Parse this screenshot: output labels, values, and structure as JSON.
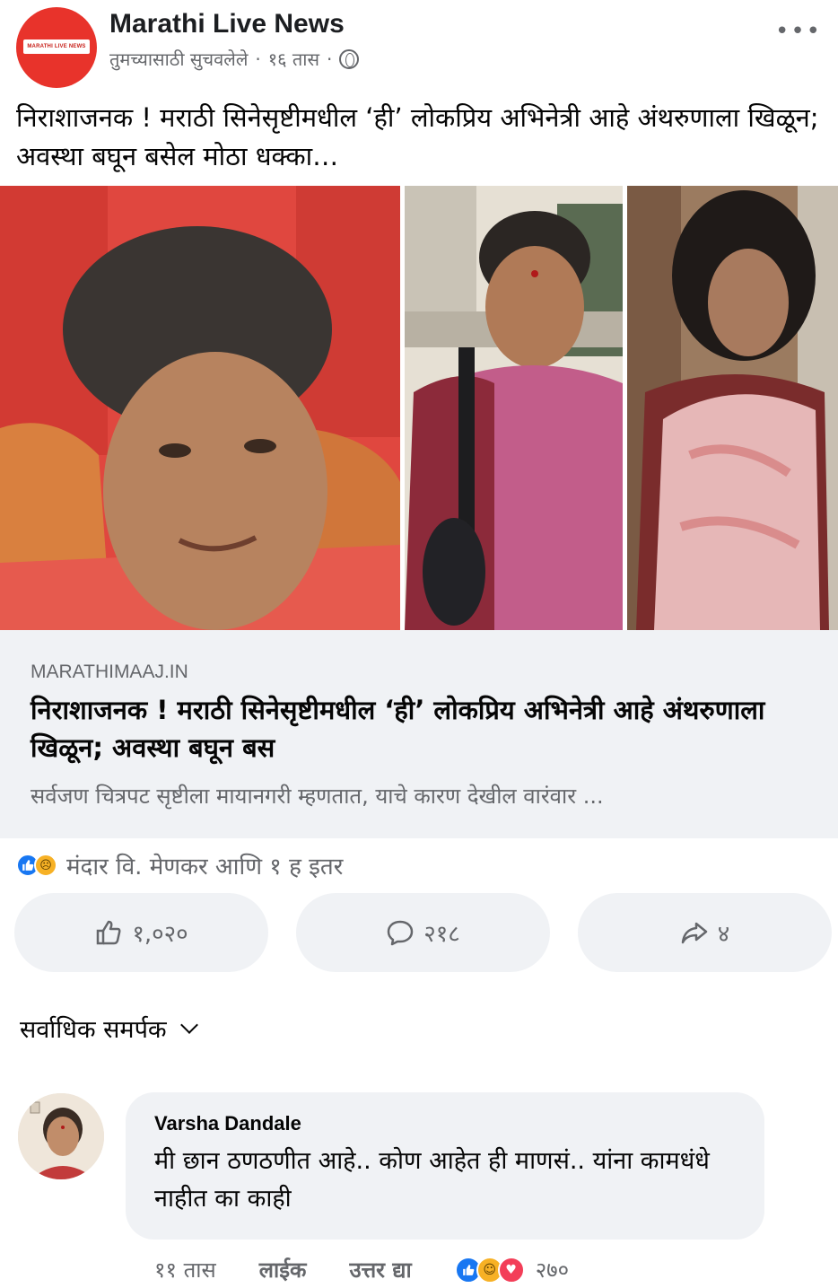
{
  "post": {
    "page_name": "Marathi Live News",
    "page_logo_text": "MARATHI LIVE NEWS",
    "suggested": "तुमच्यासाठी सुचवलेले",
    "separator": "·",
    "time": "१६ तास",
    "more": "•••",
    "text": "निराशाजनक ! मराठी सिनेसृष्टीमधील ‘ही’ लोकप्रिय अभिनेत्री आहे अंथरुणाला खिळून; अवस्था बघून बसेल मोठा धक्का…"
  },
  "link_preview": {
    "domain": "MARATHIMAAJ.IN",
    "title": "निराशाजनक ! मराठी सिनेसृष्टीमधील ‘ही’ लोकप्रिय अभिनेत्री आहे अंथरुणाला खिळून; अवस्था बघून बस",
    "description": "सर्वजण चित्रपट सृष्टीला मायानगरी म्हणतात, याचे कारण देखील वारंवार ..."
  },
  "reactions": {
    "summary": "मंदार वि. मेणकर आणि १ ह इतर",
    "types": [
      "like-icon",
      "sad-icon"
    ]
  },
  "actions": {
    "like_count": "१,०२०",
    "comment_count": "२१८",
    "share_count": "४"
  },
  "sort": {
    "label": "सर्वाधिक समर्पक"
  },
  "comment": {
    "author": "Varsha Dandale",
    "text": "मी छान ठणठणीत आहे.. कोण आहेत ही माणसं.. यांना कामधंधे नाहीत का काही",
    "time": "११ तास",
    "like_label": "लाईक",
    "reply_label": "उत्तर द्या",
    "reaction_count": "२७०",
    "reaction_types": [
      "like-icon",
      "haha-icon",
      "love-icon"
    ]
  },
  "colors": {
    "brand_blue": "#1877f2",
    "secondary_text": "#65676b",
    "button_bg": "#f0f2f5",
    "logo_red": "#e8332b"
  }
}
